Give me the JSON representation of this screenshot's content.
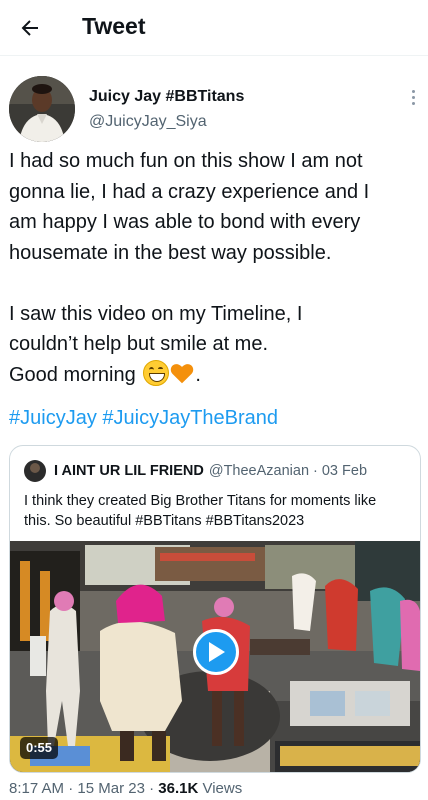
{
  "header": {
    "title": "Tweet",
    "back_icon": "arrow-left-icon"
  },
  "author": {
    "display_name": "Juicy Jay #BBTitans",
    "handle": "@JuicyJay_Siya",
    "more_icon": "more-vertical-icon"
  },
  "tweet": {
    "lines": [
      "I had so much fun on this show I am not",
      "gonna lie, I had a crazy experience and I",
      "am happy I was able to bond with every",
      "housemate in the best way possible.",
      "I saw this video on my Timeline, I",
      "couldn’t help but smile at me.",
      "Good morning",
      "."
    ],
    "emojis": [
      "grinning-face-emoji",
      "orange-heart-emoji"
    ],
    "hashtags": [
      "#JuicyJay",
      "#JuicyJayTheBrand"
    ]
  },
  "quote": {
    "name": "I AINT UR LIL FRIEND",
    "handle": "@TheeAzanian",
    "separator": "·",
    "date": "03 Feb",
    "lines": [
      "I think they created Big Brother Titans for moments like",
      "this. So beautiful  #BBTitans #BBTitans2023"
    ],
    "video": {
      "duration": "0:55",
      "play_icon": "play-icon"
    }
  },
  "meta": {
    "time": "8:17 AM",
    "sep1": "·",
    "date": "15 Mar 23",
    "sep2": "·",
    "views_count": "36.1K",
    "views_label": "Views"
  },
  "colors": {
    "accent": "#1d9bf0",
    "text": "#0f1419",
    "secondary": "#536471",
    "border": "#cfd9de"
  }
}
